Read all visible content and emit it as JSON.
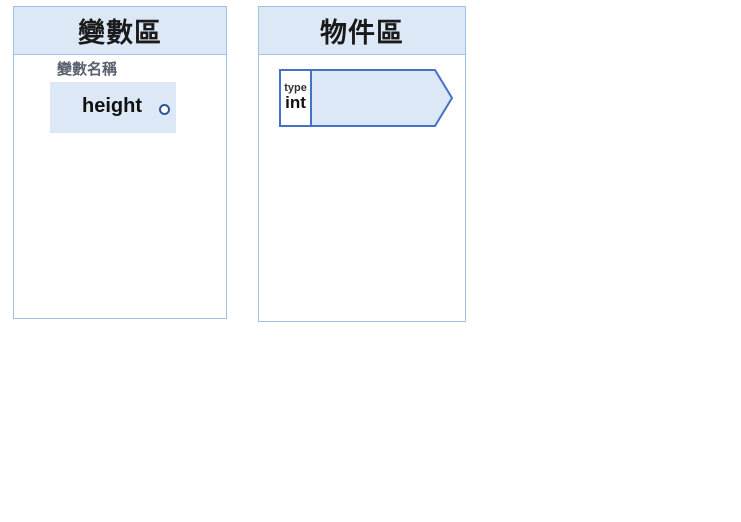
{
  "variable_area": {
    "title": "變數區",
    "name_label": "變數名稱",
    "variable": {
      "name": "height"
    }
  },
  "object_area": {
    "title": "物件區",
    "object": {
      "type_caption": "type",
      "type_value": "int",
      "value": ""
    }
  },
  "colors": {
    "panel_border": "#9dc3e6",
    "header_fill": "#dce8f6",
    "shape_stroke": "#4472c4",
    "connector": "#2f5597"
  }
}
